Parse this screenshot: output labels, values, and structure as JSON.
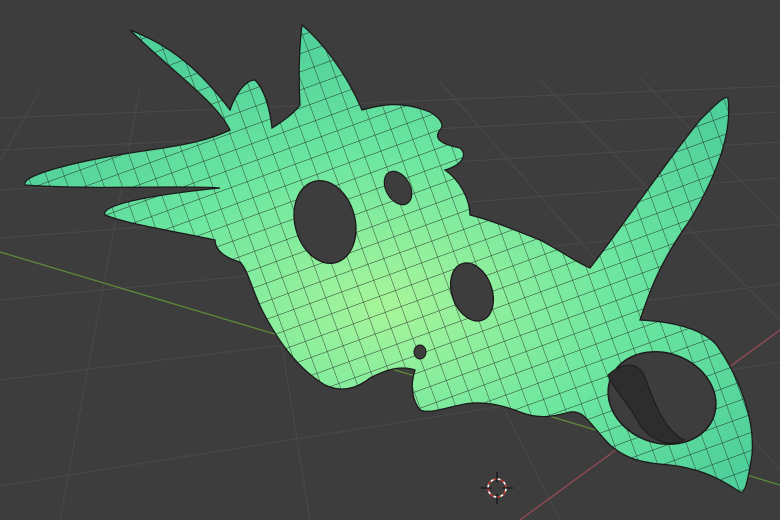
{
  "viewport": {
    "kind": "3d-viewport",
    "background": "#3d3d3d",
    "grid_color": "#4a4a4a",
    "axis_x_color": "#9b4b54",
    "axis_y_color": "#5d8f3a",
    "mesh_color": "#5fe0a6",
    "mesh_highlight": "#9df59a",
    "wire_color": "#1b1b1b",
    "icons": {
      "cursor": "3d-cursor-icon"
    }
  }
}
